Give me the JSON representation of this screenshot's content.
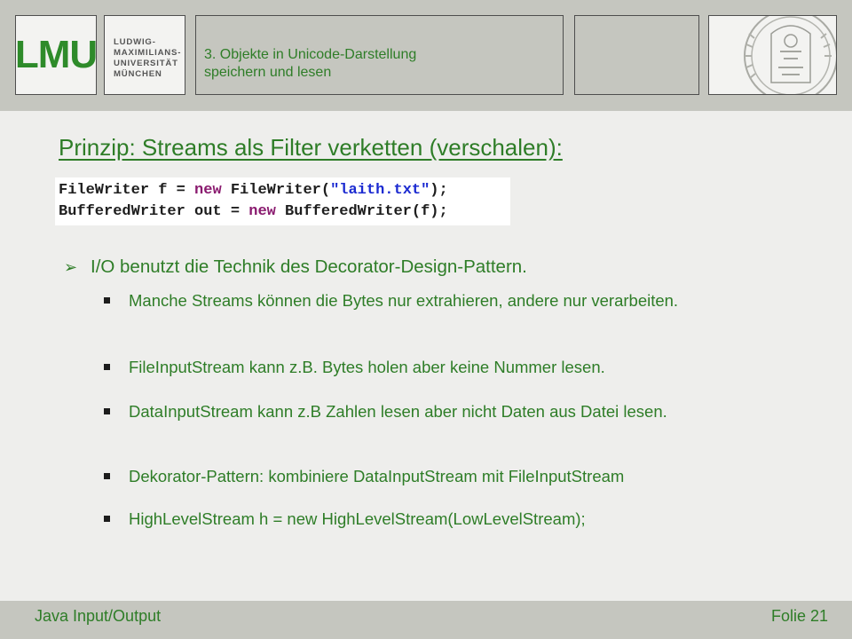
{
  "header": {
    "logo": "LMU",
    "university_lines": [
      "LUDWIG-",
      "MAXIMILIANS-",
      "UNIVERSITÄT",
      "MÜNCHEN"
    ],
    "chapter_title_line1": "3. Objekte in Unicode-Darstellung",
    "chapter_title_line2": "speichern und lesen"
  },
  "slide": {
    "heading": "Prinzip: Streams als Filter verketten (verschalen):",
    "code": {
      "line1": {
        "type": "FileWriter",
        "var": " f = ",
        "kw": "new",
        "call": " FileWriter(",
        "str": "\"laith.txt\"",
        "end": ");"
      },
      "line2": {
        "type": "BufferedWriter",
        "var": " out = ",
        "kw": "new",
        "call": " BufferedWriter(f);"
      }
    },
    "main_point": "I/O benutzt die Technik des Decorator-Design-Pattern.",
    "bullets": [
      "Manche Streams können die Bytes nur extrahieren, andere nur verarbeiten.",
      "FileInputStream kann z.B. Bytes holen aber keine Nummer lesen.",
      "DataInputStream kann z.B Zahlen lesen aber nicht Daten aus Datei lesen.",
      "Dekorator-Pattern: kombiniere DataInputStream mit FileInputStream",
      "HighLevelStream h = new HighLevelStream(LowLevelStream);"
    ]
  },
  "footer": {
    "left": "Java Input/Output",
    "right": "Folie 21"
  },
  "colors": {
    "text_green": "#2e7d27",
    "header_bg": "#c5c6bf",
    "slide_bg": "#eeeeec"
  }
}
